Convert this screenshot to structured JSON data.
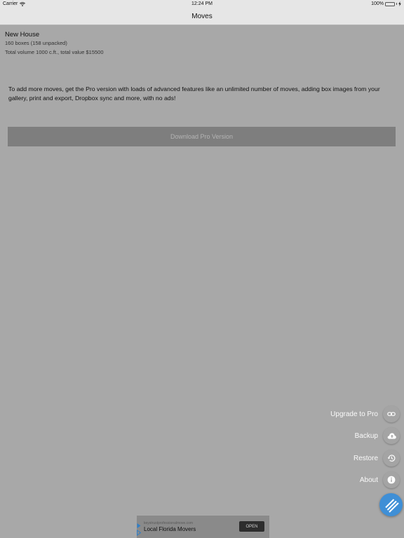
{
  "status_bar": {
    "carrier": "Carrier",
    "time": "12:24 PM",
    "battery": "100%"
  },
  "nav": {
    "title": "Moves"
  },
  "move": {
    "name": "New House",
    "boxes": "160 boxes (158 unpacked)",
    "totals": "Total volume 1000 c.ft., total value $15500"
  },
  "promo": {
    "text": "To add more moves, get the Pro version with loads of advanced features like an unlimited number of moves, adding box images from your gallery, print and export, Dropbox sync and more, with no ads!",
    "button_label": "Download Pro Version"
  },
  "fab_menu": {
    "items": [
      {
        "label": "Upgrade to Pro",
        "icon": "link-icon"
      },
      {
        "label": "Backup",
        "icon": "cloud-upload-icon"
      },
      {
        "label": "Restore",
        "icon": "history-icon"
      },
      {
        "label": "About",
        "icon": "info-icon"
      }
    ],
    "main_icon": "menu-stripes-icon",
    "accent_color": "#3f8fd6"
  },
  "ad": {
    "url": "keystrustprofessionalmove.com",
    "title": "Local Florida Movers",
    "open_label": "OPEN"
  }
}
